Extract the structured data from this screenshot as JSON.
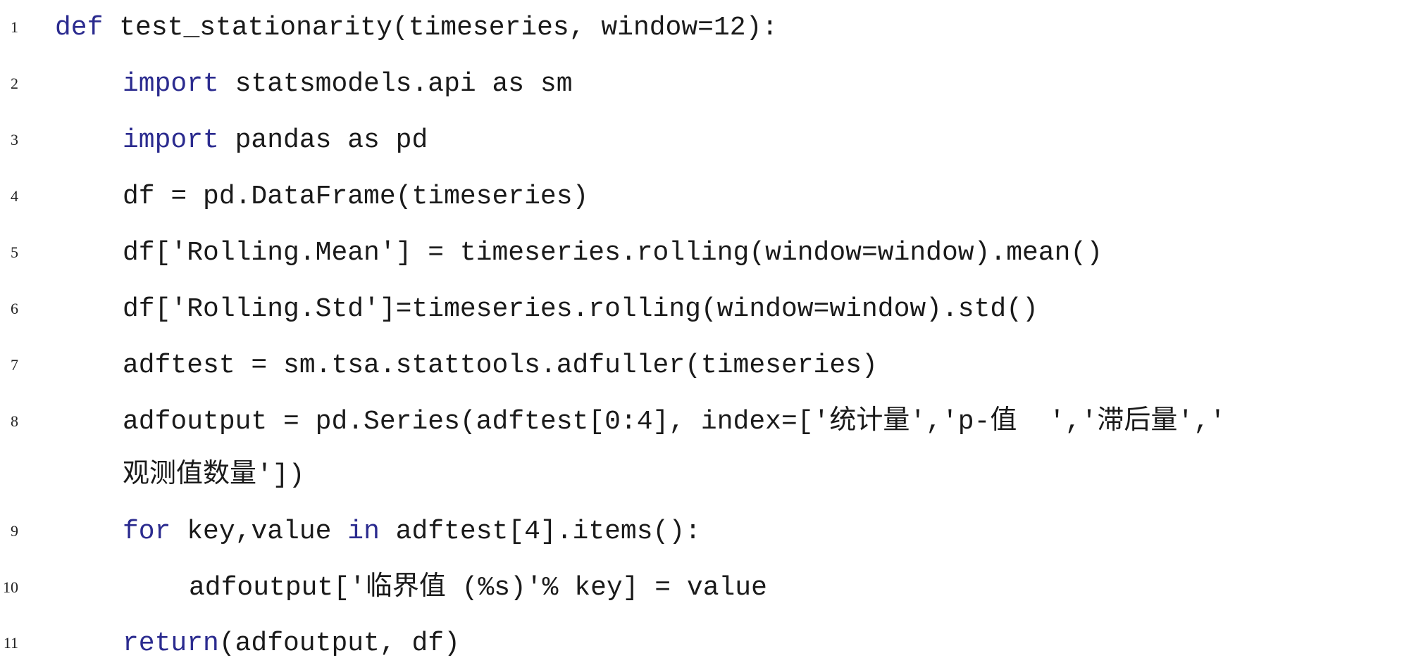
{
  "code": {
    "lines": [
      {
        "number": "1",
        "keyword": "def",
        "text": " test_stationarity(timeseries, window=12):"
      },
      {
        "number": "2",
        "keyword": "import",
        "text": " statsmodels.api as sm"
      },
      {
        "number": "3",
        "keyword": "import",
        "text": " pandas as pd"
      },
      {
        "number": "4",
        "text": "df = pd.DataFrame(timeseries)"
      },
      {
        "number": "5",
        "text": "df['Rolling.Mean'] = timeseries.rolling(window=window).mean()"
      },
      {
        "number": "6",
        "text": "df['Rolling.Std']=timeseries.rolling(window=window).std()"
      },
      {
        "number": "7",
        "text": "adftest = sm.tsa.stattools.adfuller(timeseries)"
      },
      {
        "number": "8",
        "text": "adfoutput = pd.Series(adftest[0:4], index=['统计量','p-值  ','滞后量','",
        "continuation": "观测值数量'])"
      },
      {
        "number": "9",
        "keyword": "for",
        "text_a": " key,value ",
        "keyword_b": "in",
        "text": " adftest[4].items():"
      },
      {
        "number": "10",
        "text": "adfoutput['临界值 (%s)'% key] = value"
      },
      {
        "number": "11",
        "keyword": "return",
        "text": "(adfoutput, df)"
      }
    ]
  },
  "colors": {
    "keyword": "#2b2b8f",
    "text": "#1a1a1a",
    "line_number": "#222222",
    "background": "#ffffff"
  }
}
